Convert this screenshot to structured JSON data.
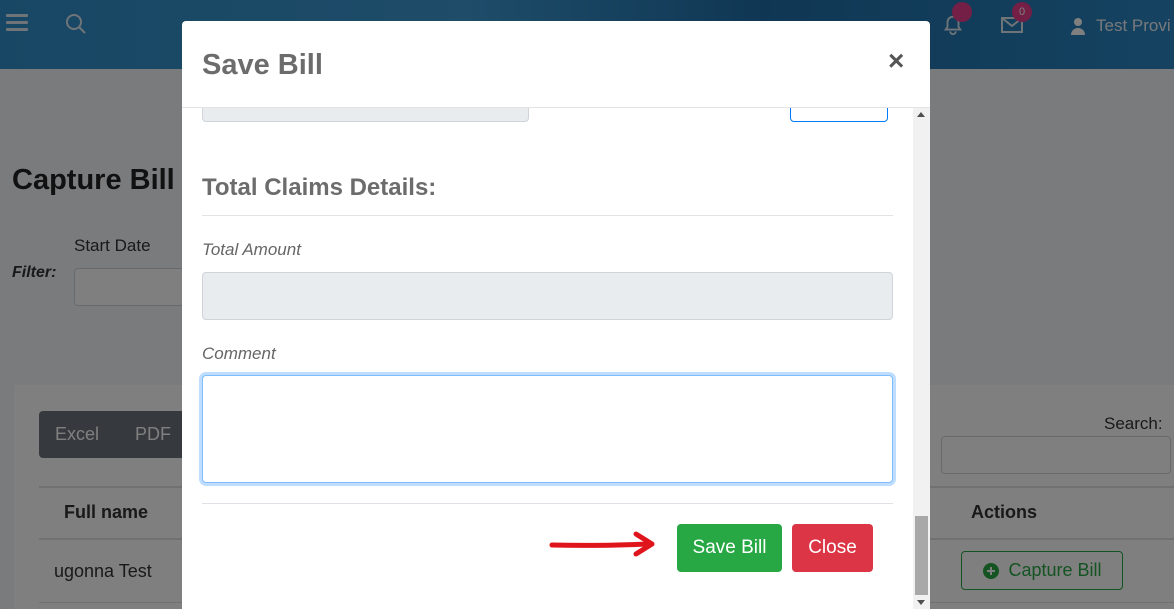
{
  "header": {
    "notifications_count": "",
    "messages_count": "0",
    "user_name": "Test Provi"
  },
  "page": {
    "title": "Capture Bill",
    "filter_label": "Filter:",
    "start_date_label": "Start Date",
    "export_buttons": [
      "Excel",
      "PDF"
    ],
    "search_label": "Search:",
    "table": {
      "columns": [
        "Full name",
        "Actions"
      ],
      "rows": [
        {
          "full_name": "ugonna Test",
          "action_label": "Capture Bill"
        }
      ]
    }
  },
  "modal": {
    "title": "Save Bill",
    "close_icon": "×",
    "section_title": "Total Claims Details:",
    "total_amount_label": "Total Amount",
    "total_amount_value": "",
    "comment_label": "Comment",
    "comment_value": "",
    "save_label": "Save Bill",
    "close_label": "Close"
  },
  "colors": {
    "save": "#28a745",
    "close": "#dc3545",
    "arrow": "#e0151c",
    "badge": "#e83e8c"
  }
}
